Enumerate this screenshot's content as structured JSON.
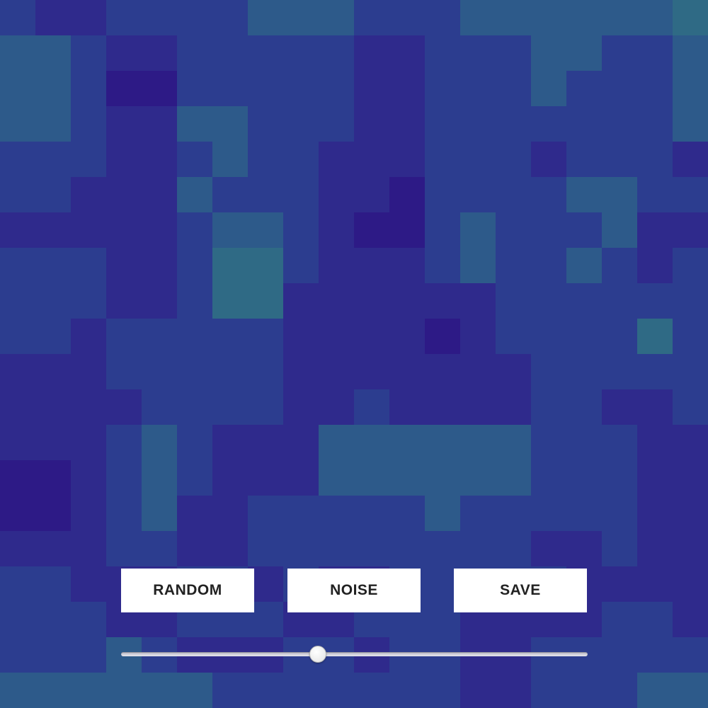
{
  "controls": {
    "random_label": "RANDOM",
    "noise_label": "NOISE",
    "save_label": "SAVE",
    "slider_value": 0.42
  },
  "colors": {
    "button_bg": "#ffffff",
    "button_text": "#222222",
    "palette": [
      "#2d1a86",
      "#2f2a8c",
      "#2c3d8f",
      "#2d5a8a",
      "#2f6a85"
    ]
  }
}
